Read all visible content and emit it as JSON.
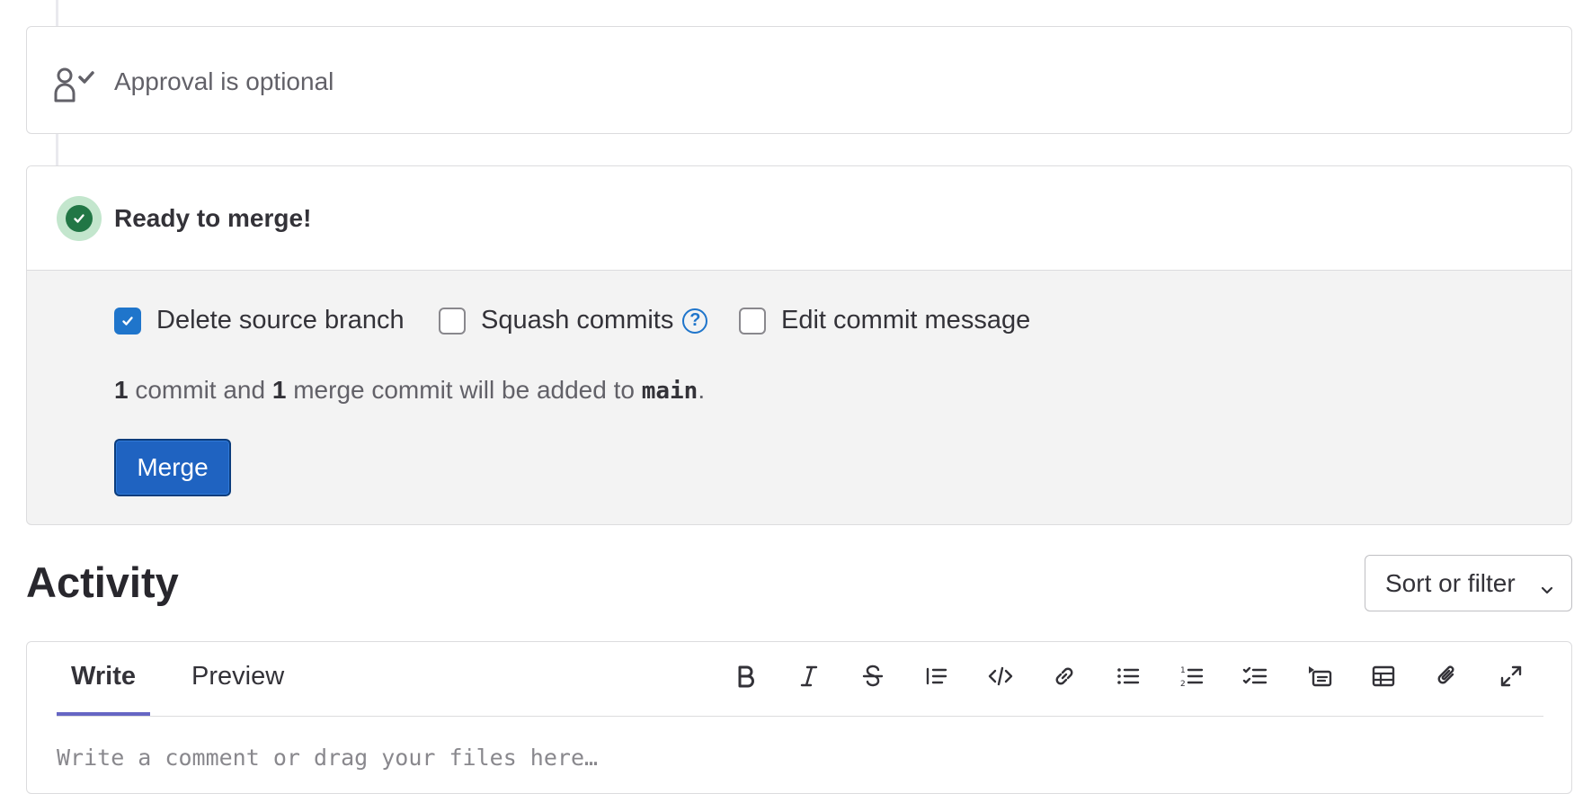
{
  "approval": {
    "text": "Approval is optional",
    "icon": "approval-user-check-icon"
  },
  "merge_widget": {
    "status_icon": "success-check-icon",
    "title": "Ready to merge!",
    "options": {
      "delete_source_branch": {
        "label": "Delete source branch",
        "checked": true
      },
      "squash_commits": {
        "label": "Squash commits",
        "checked": false,
        "help": "?"
      },
      "edit_commit_message": {
        "label": "Edit commit message",
        "checked": false
      }
    },
    "summary": {
      "commit_count": "1",
      "text1": " commit and ",
      "merge_commit_count": "1",
      "text2": " merge commit will be added to ",
      "branch": "main",
      "text3": "."
    },
    "merge_button": "Merge"
  },
  "activity": {
    "title": "Activity",
    "sort_button": "Sort or filter"
  },
  "editor": {
    "tabs": {
      "write": "Write",
      "preview": "Preview"
    },
    "toolbar": [
      "bold-icon",
      "italic-icon",
      "strikethrough-icon",
      "quote-icon",
      "code-icon",
      "link-icon",
      "bullet-list-icon",
      "numbered-list-icon",
      "task-list-icon",
      "collapsible-section-icon",
      "table-icon",
      "attach-file-icon",
      "fullscreen-icon"
    ],
    "placeholder": "Write a comment or drag your files here…"
  },
  "colors": {
    "accent": "#1f75cb",
    "merge_button": "#1f63c1",
    "success": "#217645",
    "success_bg": "#c3e6cd",
    "tab_underline": "#6666c4"
  }
}
